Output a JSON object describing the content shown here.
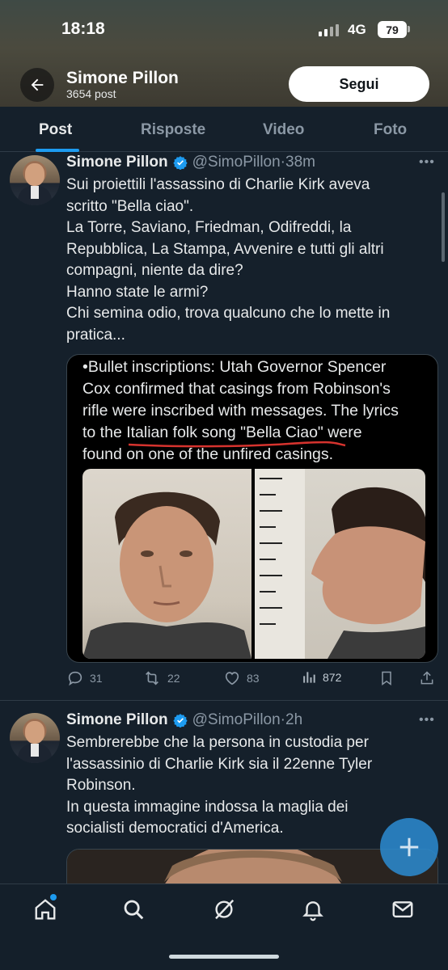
{
  "status_bar": {
    "time": "18:18",
    "network": "4G",
    "battery": "79"
  },
  "profile": {
    "name": "Simone Pillon",
    "post_count": "3654 post",
    "follow_label": "Segui"
  },
  "tabs": [
    {
      "label": "Post",
      "active": true
    },
    {
      "label": "Risposte",
      "active": false
    },
    {
      "label": "Video",
      "active": false
    },
    {
      "label": "Foto",
      "active": false
    }
  ],
  "tweets": [
    {
      "author": "Simone Pillon",
      "handle": "@SimoPillon",
      "time": "38m",
      "text_lines": [
        "Sui proiettili l'assassino di Charlie Kirk aveva",
        "scritto \"Bella ciao\".",
        "La Torre, Saviano, Friedman, Odifreddi, la",
        "Repubblica, La Stampa, Avvenire e tutti gli altri",
        "compagni, niente da dire?",
        "Hanno state le armi?",
        "Chi semina odio, trova qualcuno che lo mette in",
        "pratica..."
      ],
      "media_text_lines": [
        "•Bullet inscriptions: Utah Governor Spencer",
        "Cox confirmed that casings from Robinson's",
        "rifle were inscribed with messages. The lyrics",
        "to the Italian folk song \"Bella Ciao\" were",
        "found on one of the unfired casings."
      ],
      "stats": {
        "replies": "31",
        "reposts": "22",
        "likes": "83",
        "views": "872"
      }
    },
    {
      "author": "Simone Pillon",
      "handle": "@SimoPillon",
      "time": "2h",
      "text_lines": [
        "Sembrerebbe che la persona in custodia per",
        "l'assassinio di Charlie Kirk sia il 22enne Tyler",
        "Robinson.",
        "In questa immagine indossa la maglia dei",
        "socialisti democratici d'America."
      ]
    }
  ],
  "bottom_nav": [
    "home-icon",
    "search-icon",
    "grok-icon",
    "notifications-icon",
    "messages-icon"
  ],
  "colors": {
    "accent": "#1d9bf0",
    "background": "#15202b",
    "muted": "#8b98a5"
  }
}
